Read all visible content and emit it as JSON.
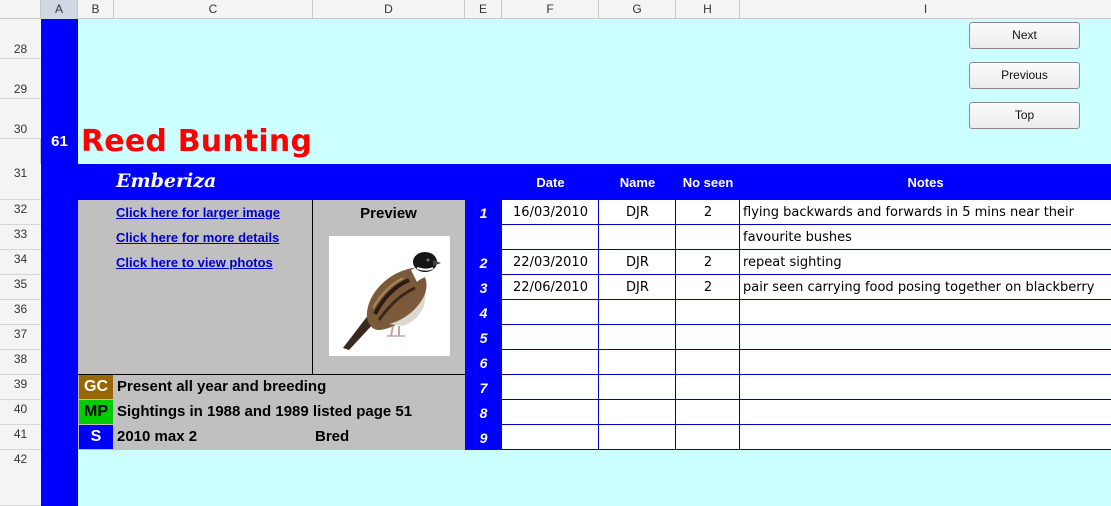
{
  "columns": [
    "A",
    "B",
    "C",
    "D",
    "E",
    "F",
    "G",
    "H",
    "I"
  ],
  "rows": [
    "28",
    "29",
    "30",
    "31",
    "32",
    "33",
    "34",
    "35",
    "36",
    "37",
    "38",
    "39",
    "40",
    "41",
    "42"
  ],
  "entry": {
    "number": "61",
    "title": "Reed Bunting",
    "genus": "Emberiza"
  },
  "nav": {
    "next": "Next",
    "previous": "Previous",
    "top": "Top"
  },
  "headers": {
    "date": "Date",
    "name": "Name",
    "no_seen": "No seen",
    "notes": "Notes"
  },
  "links": {
    "larger_image": "Click here for larger image",
    "more_details": "Click here for more details",
    "view_photos": "Click here to view photos"
  },
  "preview_label": "Preview",
  "status": [
    {
      "code": "GC",
      "text": "Present all year and breeding",
      "color": "#996600",
      "text_color": "#ffffff"
    },
    {
      "code": "MP",
      "text": "Sightings in 1988 and 1989 listed page 51",
      "color": "#00cc00",
      "text_color": "#000000"
    },
    {
      "code": "S",
      "text": "2010 max 2",
      "extra": "Bred",
      "color": "#0000ff",
      "text_color": "#ffffff"
    }
  ],
  "sightings": [
    {
      "num": "1",
      "date": "16/03/2010",
      "name": "DJR",
      "seen": "2",
      "notes": "flying backwards and forwards in 5 mins near their"
    },
    {
      "num": "",
      "date": "",
      "name": "",
      "seen": "",
      "notes": "favourite bushes"
    },
    {
      "num": "2",
      "date": "22/03/2010",
      "name": "DJR",
      "seen": "2",
      "notes": "repeat sighting"
    },
    {
      "num": "3",
      "date": "22/06/2010",
      "name": "DJR",
      "seen": "2",
      "notes": "pair seen carrying food posing together on blackberry"
    },
    {
      "num": "4",
      "date": "",
      "name": "",
      "seen": "",
      "notes": ""
    },
    {
      "num": "5",
      "date": "",
      "name": "",
      "seen": "",
      "notes": ""
    },
    {
      "num": "6",
      "date": "",
      "name": "",
      "seen": "",
      "notes": ""
    },
    {
      "num": "7",
      "date": "",
      "name": "",
      "seen": "",
      "notes": ""
    },
    {
      "num": "8",
      "date": "",
      "name": "",
      "seen": "",
      "notes": ""
    },
    {
      "num": "9",
      "date": "",
      "name": "",
      "seen": "",
      "notes": ""
    }
  ],
  "colors": {
    "sheet_bg": "#ccffff",
    "band": "#0000ff",
    "title": "#ff0000",
    "panel": "#c0c0c0"
  }
}
